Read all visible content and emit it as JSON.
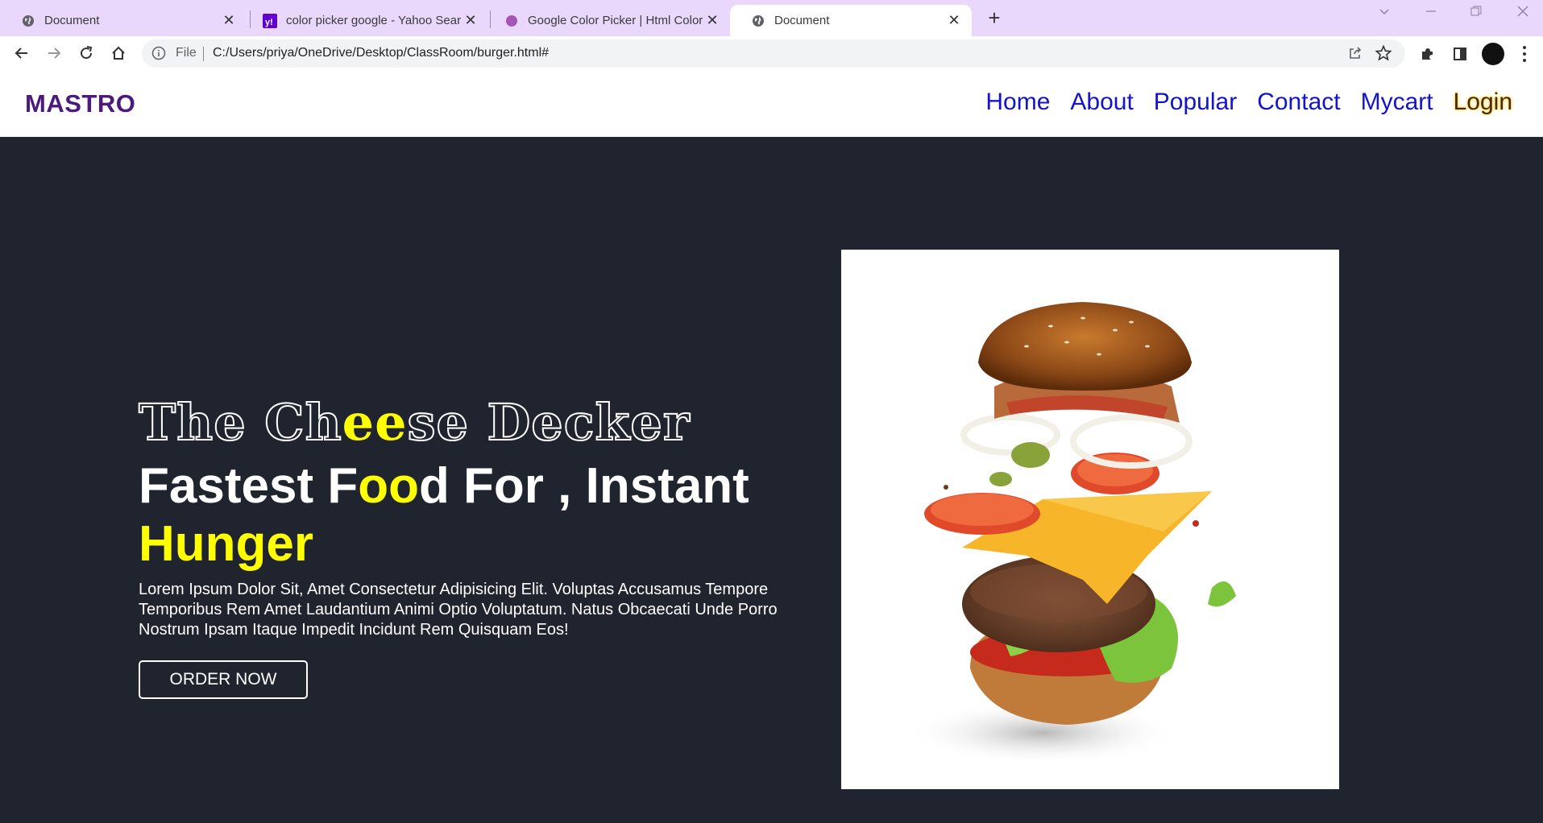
{
  "browser": {
    "tabs": [
      {
        "label": "Document",
        "icon": "globe-icon",
        "active": false
      },
      {
        "label": "color picker google - Yahoo Sear",
        "icon": "yahoo-icon",
        "active": false
      },
      {
        "label": "Google Color Picker | Html Color",
        "icon": "purple-dot-icon",
        "active": false
      },
      {
        "label": "Document",
        "icon": "globe-icon",
        "active": true
      }
    ],
    "scheme_label": "File",
    "url": "C:/Users/priya/OneDrive/Desktop/ClassRoom/burger.html#"
  },
  "site": {
    "logo": "MASTRO",
    "nav": [
      "Home",
      "About",
      "Popular",
      "Contact",
      "Mycart",
      "Login"
    ]
  },
  "hero": {
    "title1": [
      "The Ch",
      "ee",
      "se Decker"
    ],
    "title2": [
      "Fastest F",
      "oo",
      "d For , Instant"
    ],
    "title2_line2": "Hunger",
    "description": "Lorem Ipsum Dolor Sit, Amet Consectetur Adipisicing Elit. Voluptas Accusamus Tempore Temporibus Rem Amet Laudantium Animi Optio Voluptatum. Natus Obcaecati Unde Porro Nostrum Ipsam Itaque Impedit Incidunt Rem Quisquam Eos!",
    "button": "ORDER NOW",
    "image": "burger-image"
  },
  "colors": {
    "accent_yellow": "#ffff00",
    "nav_link": "#1414c8",
    "logo": "#4b1a7a",
    "hero_bg": "#20242f",
    "tabbar_bg": "#e9d8fb"
  }
}
